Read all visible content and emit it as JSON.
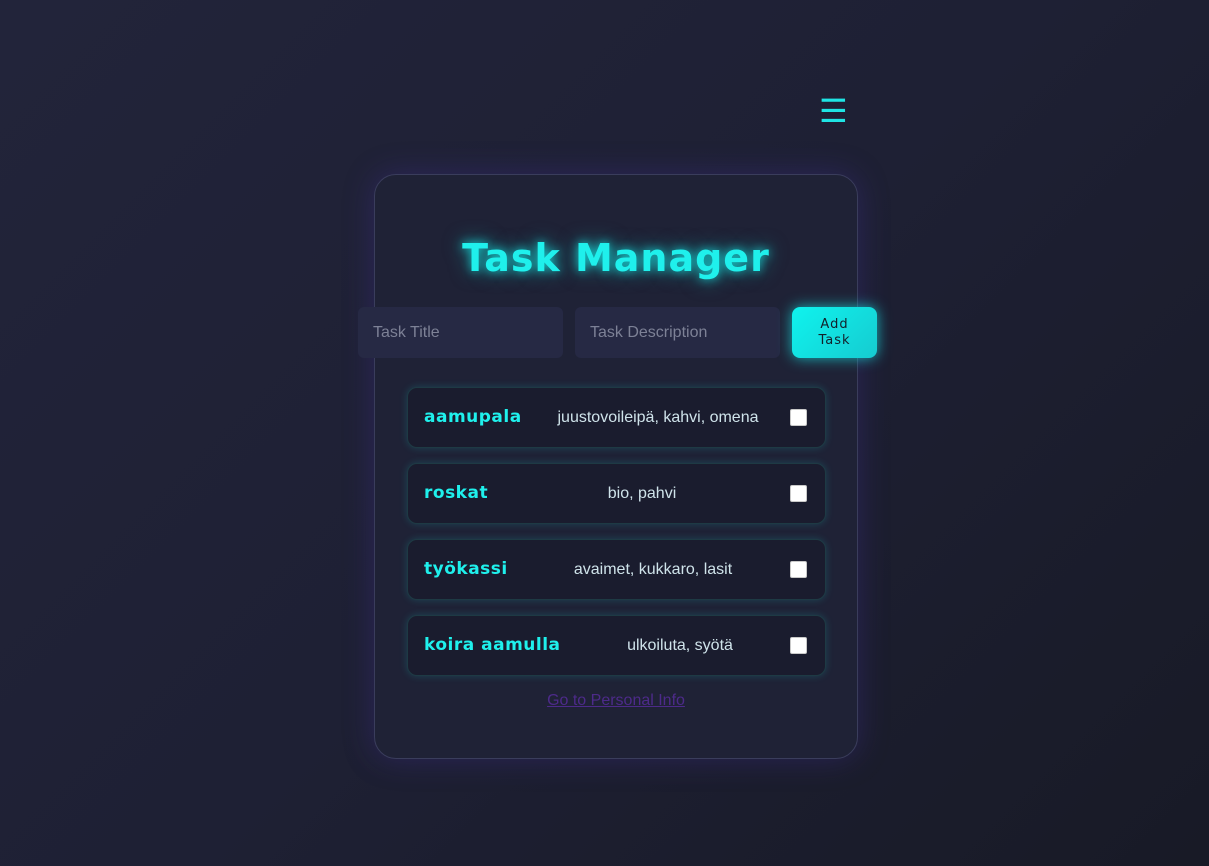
{
  "menu": {
    "icon": "hamburger-menu-icon",
    "glyph": "☰"
  },
  "header": {
    "title": "Task Manager"
  },
  "form": {
    "title_placeholder": "Task Title",
    "title_value": "",
    "desc_placeholder": "Task Description",
    "desc_value": "",
    "add_label": "Add Task"
  },
  "tasks": [
    {
      "title": "aamupala",
      "description": "juustovoileipä, kahvi, omena",
      "done": false
    },
    {
      "title": "roskat",
      "description": "bio, pahvi",
      "done": false
    },
    {
      "title": "työkassi",
      "description": "avaimet, kukkaro, lasit",
      "done": false
    },
    {
      "title": "koira aamulla",
      "description": "ulkoiluta, syötä",
      "done": false
    }
  ],
  "footer": {
    "link_label": "Go to Personal Info"
  },
  "colors": {
    "accent": "#1ff0ec",
    "background": "#1e2034",
    "card": "#1f2236",
    "link": "#4d2a8a"
  }
}
